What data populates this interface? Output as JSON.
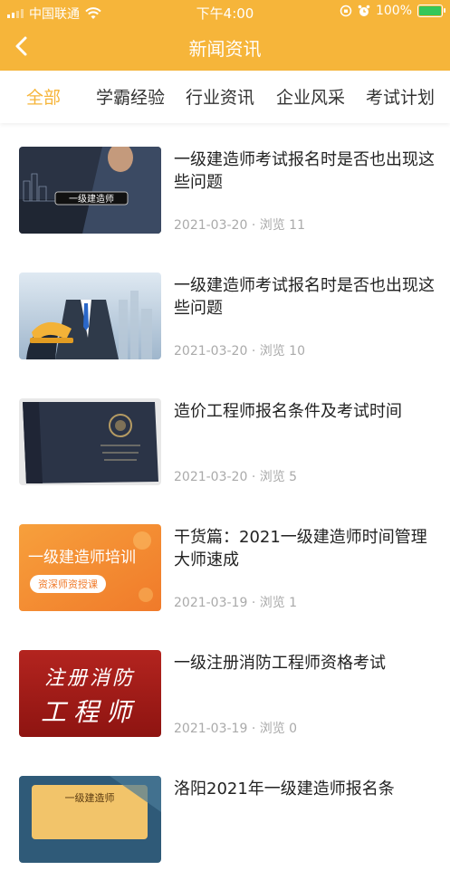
{
  "status_bar": {
    "carrier": "中国联通",
    "time": "下午4:00",
    "battery": "100%",
    "battery_level": 1.0
  },
  "nav": {
    "title": "新闻资讯",
    "back_icon": "chevron-left-icon"
  },
  "tabs": [
    {
      "label": "全部",
      "active": true
    },
    {
      "label": "学霸经验",
      "active": false
    },
    {
      "label": "行业资讯",
      "active": false
    },
    {
      "label": "企业风采",
      "active": false
    },
    {
      "label": "考试计划",
      "active": false
    }
  ],
  "articles": [
    {
      "title": "一级建造师考试报名时是否也出现这些问题",
      "date": "2021-03-20",
      "views": "浏览 11",
      "thumb_text": "一级建造师"
    },
    {
      "title": "一级建造师考试报名时是否也出现这些问题",
      "date": "2021-03-20",
      "views": "浏览 10"
    },
    {
      "title": "造价工程师报名条件及考试时间",
      "date": "2021-03-20",
      "views": "浏览 5"
    },
    {
      "title": "干货篇：2021一级建造师时间管理大师速成",
      "date": "2021-03-19",
      "views": "浏览 1",
      "thumb_text": "一级建造师培训",
      "thumb_badge": "资深师资授课"
    },
    {
      "title": "一级注册消防工程师资格考试",
      "date": "2021-03-19",
      "views": "浏览 0",
      "thumb_line1": "注册消防",
      "thumb_line2": "工程师"
    },
    {
      "title": "洛阳2021年一级建造师报名条",
      "thumb_text": "一级建造师"
    }
  ],
  "meta_separator": "·"
}
